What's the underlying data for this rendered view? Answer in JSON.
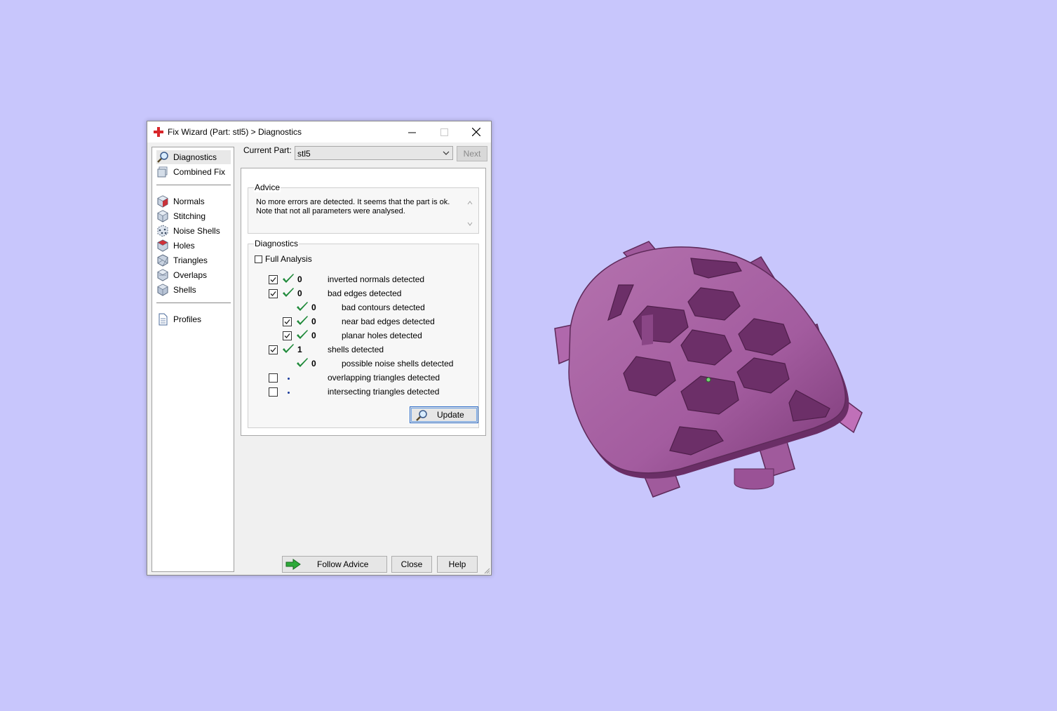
{
  "window": {
    "title": "Fix Wizard (Part: stl5) > Diagnostics",
    "controls": {
      "minimize": "minimize",
      "maximize": "maximize",
      "close": "close"
    }
  },
  "sidebar": {
    "items": [
      {
        "label": "Diagnostics",
        "icon": "magnifier-icon",
        "selected": true
      },
      {
        "label": "Combined Fix",
        "icon": "stacked-pages-icon"
      },
      {
        "label": "Normals",
        "icon": "cube-red-face-icon"
      },
      {
        "label": "Stitching",
        "icon": "cube-stitch-icon"
      },
      {
        "label": "Noise Shells",
        "icon": "dotted-cube-icon"
      },
      {
        "label": "Holes",
        "icon": "cube-hole-icon"
      },
      {
        "label": "Triangles",
        "icon": "cube-triangles-icon"
      },
      {
        "label": "Overlaps",
        "icon": "cube-overlap-icon"
      },
      {
        "label": "Shells",
        "icon": "cube-shells-icon"
      },
      {
        "label": "Profiles",
        "icon": "document-icon"
      }
    ]
  },
  "header": {
    "current_part_label": "Current Part:",
    "current_part_value": "stl5",
    "next_label": "Next"
  },
  "advice": {
    "title": "Advice",
    "text": "No more errors are detected. It seems that the part is ok. Note that not all parameters were analysed."
  },
  "diagnostics": {
    "title": "Diagnostics",
    "full_analysis_label": "Full Analysis",
    "full_analysis_checked": false,
    "rows": [
      {
        "checkbox": true,
        "checked": true,
        "status": "ok",
        "count": "0",
        "label": "inverted normals detected",
        "indent": 0
      },
      {
        "checkbox": true,
        "checked": true,
        "status": "ok",
        "count": "0",
        "label": "bad edges detected",
        "indent": 0
      },
      {
        "checkbox": false,
        "checked": false,
        "status": "ok",
        "count": "0",
        "label": "bad contours detected",
        "indent": 1
      },
      {
        "checkbox": true,
        "checked": true,
        "status": "ok",
        "count": "0",
        "label": "near bad edges detected",
        "indent": 1
      },
      {
        "checkbox": true,
        "checked": true,
        "status": "ok",
        "count": "0",
        "label": "planar holes detected",
        "indent": 1
      },
      {
        "checkbox": true,
        "checked": true,
        "status": "ok",
        "count": "1",
        "label": "shells detected",
        "indent": 0
      },
      {
        "checkbox": false,
        "checked": false,
        "status": "ok",
        "count": "0",
        "label": "possible noise shells detected",
        "indent": 1
      },
      {
        "checkbox": true,
        "checked": false,
        "status": "none",
        "count": "",
        "label": "overlapping triangles detected",
        "indent": 0
      },
      {
        "checkbox": true,
        "checked": false,
        "status": "none",
        "count": "",
        "label": "intersecting triangles detected",
        "indent": 0
      }
    ],
    "update_label": "Update"
  },
  "footer": {
    "follow_advice_label": "Follow Advice",
    "close_label": "Close",
    "help_label": "Help"
  },
  "colors": {
    "background": "#c8c6fc",
    "model": "#a05a9e",
    "check_green": "#1f8a3a"
  }
}
